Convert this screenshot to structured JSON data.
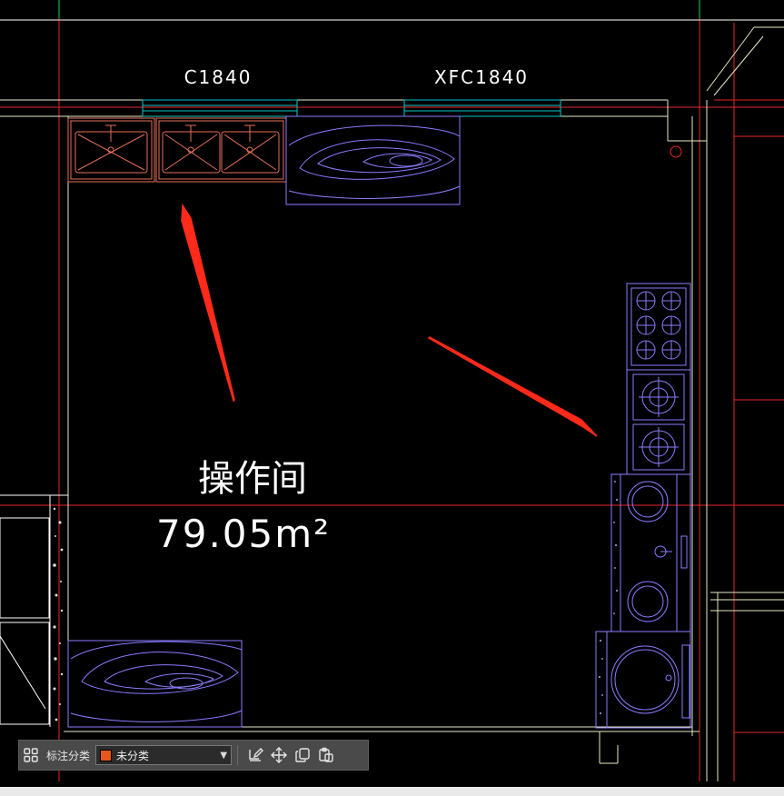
{
  "drawing": {
    "windows": [
      {
        "label": "C1840"
      },
      {
        "label": "XFC1840"
      }
    ],
    "room": {
      "name": "操作间",
      "area": "79.05m²"
    }
  },
  "colors": {
    "axis_line": "#e8262a",
    "wall_line": "#ffff00",
    "window_line": "#00c8c8",
    "furniture_blue": "#8a7cff",
    "sink_color": "#e8705a",
    "annotation_arrow": "#ff2a1a",
    "toolbar_bg": "#4a4a4a",
    "category_swatch": "#e8571a"
  },
  "toolbar": {
    "grid_icon": "grid-icon",
    "category_label": "标注分类",
    "category_value": "未分类",
    "edit_icon": "edit-icon",
    "move_icon": "move-icon",
    "copy_icon": "copy-icon",
    "paste_icon": "paste-icon"
  }
}
